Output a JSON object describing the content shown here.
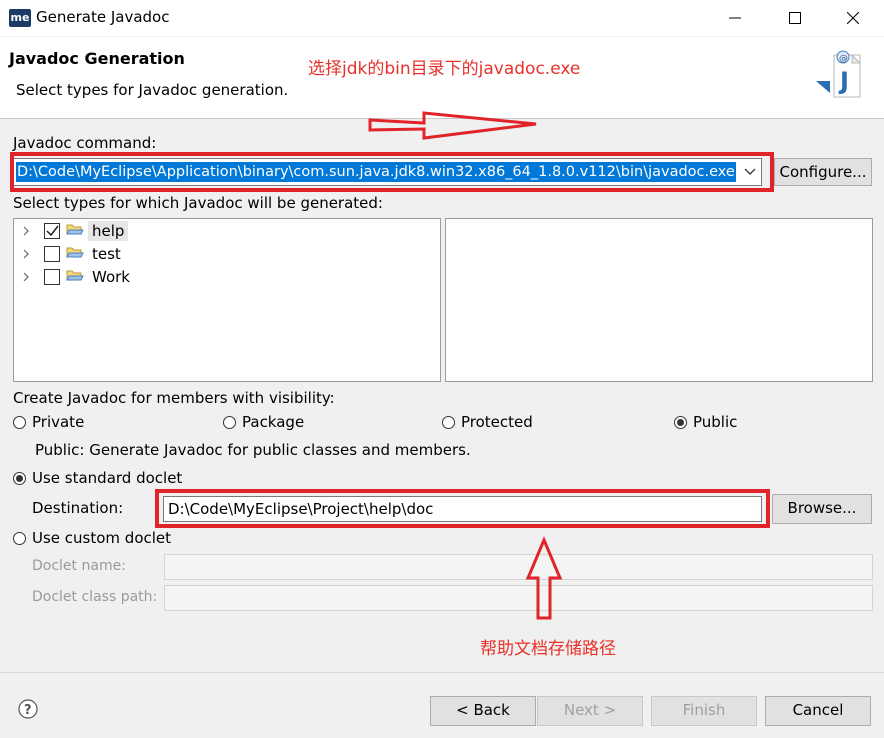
{
  "window": {
    "title": "Generate Javadoc",
    "app_logo": "me"
  },
  "header": {
    "title": "Javadoc Generation",
    "description": "Select types for Javadoc generation.",
    "annotation_top": "选择jdk的bin目录下的javadoc.exe",
    "icon": "javadoc-wizard-icon"
  },
  "command": {
    "label": "Javadoc command:",
    "value": "D:\\Code\\MyEclipse\\Application\\binary\\com.sun.java.jdk8.win32.x86_64_1.8.0.v112\\bin\\javadoc.exe",
    "configure_label": "Configure..."
  },
  "types": {
    "label": "Select types for which Javadoc will be generated:",
    "items": [
      {
        "label": "help",
        "checked": true
      },
      {
        "label": "test",
        "checked": false
      },
      {
        "label": "Work",
        "checked": false
      }
    ]
  },
  "visibility": {
    "label": "Create Javadoc for members with visibility:",
    "options": [
      "Private",
      "Package",
      "Protected",
      "Public"
    ],
    "selected": "Public",
    "description": "Public: Generate Javadoc for public classes and members."
  },
  "doclet": {
    "standard_label": "Use standard doclet",
    "destination_label": "Destination:",
    "destination_value": "D:\\Code\\MyEclipse\\Project\\help\\doc",
    "browse_label": "Browse...",
    "custom_label": "Use custom doclet",
    "name_label": "Doclet name:",
    "classpath_label": "Doclet class path:"
  },
  "annotation_bottom": "帮助文档存储路径",
  "footer": {
    "back_label": "< Back",
    "next_label": "Next >",
    "finish_label": "Finish",
    "cancel_label": "Cancel"
  },
  "colors": {
    "annotation": "#e8312a",
    "highlight": "#0078d7"
  }
}
